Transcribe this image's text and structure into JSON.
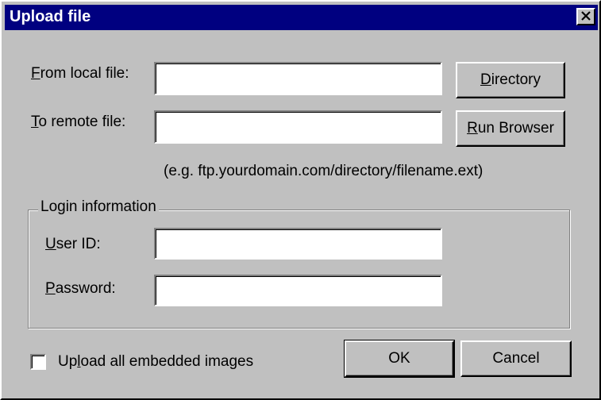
{
  "window": {
    "title": "Upload file",
    "close_glyph": "✕"
  },
  "form": {
    "from_label_first": "F",
    "from_label_rest": "rom local file:",
    "from_value": "",
    "to_label_first": "T",
    "to_label_rest": "o remote file:",
    "to_value": "",
    "example_hint": "(e.g. ftp.yourdomain.com/directory/filename.ext)"
  },
  "buttons": {
    "directory_first": "D",
    "directory_rest": "irectory",
    "run_browser_first": "R",
    "run_browser_rest": "un Browser",
    "ok": "OK",
    "cancel": "Cancel"
  },
  "login": {
    "group_label": "Login information",
    "user_label_first": "U",
    "user_label_rest": "ser ID:",
    "user_value": "",
    "password_label_first": "P",
    "password_label_rest": "assword:",
    "password_value": ""
  },
  "options": {
    "embed_label_before": "Up",
    "embed_label_underlined": "l",
    "embed_label_after": "oad all embedded images",
    "embed_checked": false
  },
  "colors": {
    "face": "#c0c0c0",
    "titlebar": "#000080"
  }
}
